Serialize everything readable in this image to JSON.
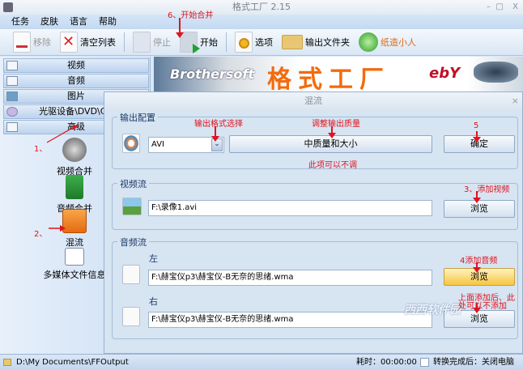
{
  "window": {
    "title": "格式工厂 2.15",
    "minimize": "–",
    "maximize": "□",
    "close": "X"
  },
  "menu": [
    "任务",
    "皮肤",
    "语言",
    "帮助"
  ],
  "toolbar": {
    "remove": "移除",
    "clear": "清空列表",
    "stop": "停止",
    "start": "开始",
    "options": "选项",
    "output_folder": "输出文件夹",
    "paper_man": "纸造小人"
  },
  "sidebar": {
    "categories": [
      "视频",
      "音频",
      "图片",
      "光驱设备\\DVD\\CD",
      "高级"
    ],
    "tools": [
      "视频合并",
      "音频合并",
      "混流",
      "多媒体文件信息"
    ]
  },
  "banner": {
    "brand": "Brothersoft",
    "title": "格式工厂",
    "ebay": "ebY"
  },
  "dialog": {
    "title": "混流",
    "close": "×",
    "output": {
      "label": "输出配置",
      "format": "AVI",
      "quality": "中质量和大小",
      "ok": "确定"
    },
    "video": {
      "label": "视频流",
      "path": "F:\\录像1.avi",
      "browse": "浏览"
    },
    "audio": {
      "label": "音频流",
      "left_label": "左",
      "left_path": "F:\\赫宝仪p3\\赫宝仪-B无奈的思绪.wma",
      "right_label": "右",
      "right_path": "F:\\赫宝仪p3\\赫宝仪-B无奈的思绪.wma",
      "browse": "浏览"
    }
  },
  "annotations": {
    "a1": "1、",
    "a2": "2、",
    "a3": "3、添加视频",
    "a4": "4添加音频",
    "a5": "5",
    "a6": "6、开始合并",
    "fmt": "输出格式选择",
    "quality": "调整输出质量",
    "optional": "此项可以不调",
    "right_note1": "上面添加后、此",
    "right_note2": "处可以不添加"
  },
  "watermark": "西西软件园",
  "status": {
    "path": "D:\\My Documents\\FFOutput",
    "elapsed": "耗时：00:00:00",
    "after": "转换完成后：关闭电脑"
  }
}
